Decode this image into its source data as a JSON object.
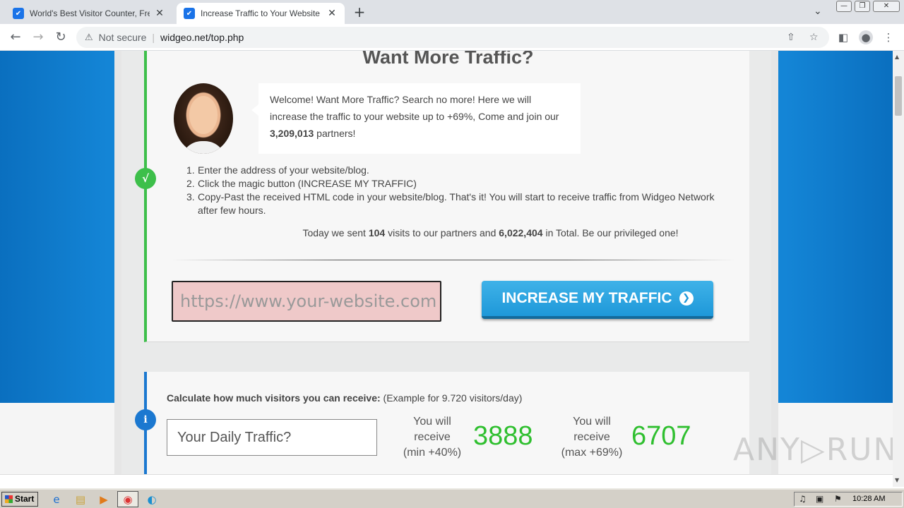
{
  "browser": {
    "tabs": [
      {
        "title": "World's Best Visitor Counter, Free hi",
        "favicon": "widgeo-icon",
        "active": false
      },
      {
        "title": "Increase Traffic to Your Website by",
        "favicon": "widgeo-icon",
        "active": true
      }
    ],
    "favicon_glyph": "✔",
    "close_glyph": "✕",
    "new_tab_glyph": "+",
    "tab_search_glyph": "⌄",
    "window_buttons": {
      "minimize": "—",
      "restore": "❐",
      "close": "✕"
    },
    "nav": {
      "back": "←",
      "forward": "→",
      "reload": "↻"
    },
    "security_label": "Not secure",
    "security_glyph": "⚠",
    "url": "widgeo.net/top.php",
    "share_glyph": "⇧",
    "bookmark_glyph": "☆",
    "sidepanel_glyph": "◧",
    "profile_glyph": "●",
    "menu_glyph": "⋮"
  },
  "page": {
    "headline": "Want More Traffic?",
    "welcome": {
      "pre": "Welcome! Want More Traffic? Search no more! Here we will increase the traffic to your website up to +69%, Come and join our ",
      "partners": "3,209,013",
      "post": " partners!"
    },
    "check_glyph": "√",
    "steps": [
      {
        "num": "1.",
        "text": "Enter the address of your website/blog."
      },
      {
        "num": "2.",
        "text": "Click the magic button (INCREASE MY TRAFFIC)"
      },
      {
        "num": "3.",
        "text": "Copy-Past the received HTML code in your website/blog. That's it! You will start to receive traffic from Widgeo Network after few hours."
      }
    ],
    "summary": {
      "pre": "Today we sent ",
      "today": "104",
      "mid": " visits to our partners and ",
      "total": "6,022,404",
      "post": " in Total. Be our privileged one!"
    },
    "url_input_placeholder": "https://www.your-website.com",
    "cta_label": "INCREASE MY TRAFFIC",
    "cta_arrow": "❯",
    "info_glyph": "i",
    "calc": {
      "title": "Calculate how much visitors you can receive:",
      "example": " (Example for 9.720 visitors/day)",
      "input_placeholder": "Your Daily Traffic?",
      "min_label": {
        "l1": "You will",
        "l2": "receive",
        "l3": "(min +40%)"
      },
      "min_value": "3888",
      "max_label": {
        "l1": "You will",
        "l2": "receive",
        "l3": "(max +69%)"
      },
      "max_value": "6707"
    },
    "watermark": "ANY▷RUN"
  },
  "colors": {
    "accent_green": "#3dbf4a",
    "accent_blue": "#1b78d0",
    "cta_blue": "#1e98d9",
    "result_green": "#2fbf2f",
    "input_pink": "#efc9c9"
  },
  "taskbar": {
    "start_label": "Start",
    "icons": [
      {
        "name": "ie-icon",
        "glyph": "e"
      },
      {
        "name": "folder-icon",
        "glyph": "▤"
      },
      {
        "name": "media-player-icon",
        "glyph": "▶"
      },
      {
        "name": "chrome-icon",
        "glyph": "◉"
      },
      {
        "name": "edge-icon",
        "glyph": "◐"
      }
    ],
    "tray_icons": {
      "volume": "♫",
      "network": "▣",
      "flag": "⚑"
    },
    "clock": "10:28 AM"
  },
  "scroll_glyphs": {
    "up": "▲",
    "down": "▼"
  }
}
